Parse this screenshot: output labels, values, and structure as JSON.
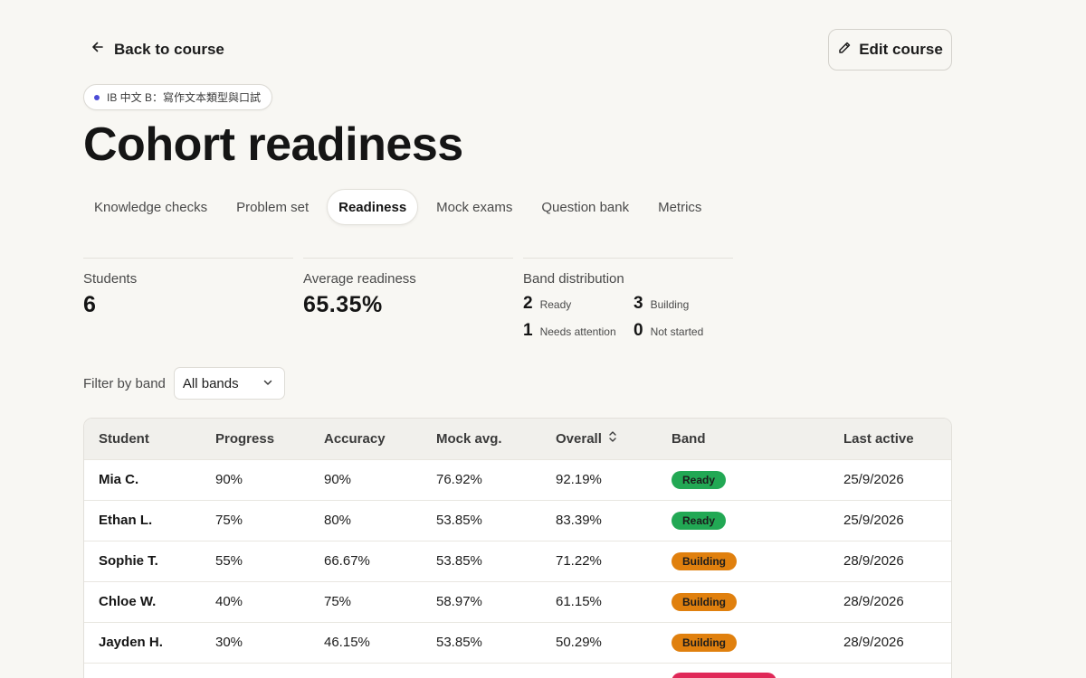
{
  "colors": {
    "ready": "#22a854",
    "building": "#e0800e",
    "needs_attention": "#e02858"
  },
  "nav": {
    "back_label": "Back to course",
    "back_icon": "arrow-left-icon"
  },
  "header": {
    "edit_label": "Edit course",
    "edit_icon": "pencil-icon"
  },
  "course_chip": {
    "label": "IB 中文 B：寫作文本類型與口試"
  },
  "page": {
    "title": "Cohort readiness"
  },
  "tabs": [
    {
      "label": "Knowledge checks",
      "active": false
    },
    {
      "label": "Problem set",
      "active": false
    },
    {
      "label": "Readiness",
      "active": true
    },
    {
      "label": "Mock exams",
      "active": false
    },
    {
      "label": "Question bank",
      "active": false
    },
    {
      "label": "Metrics",
      "active": false
    }
  ],
  "stats": {
    "students": {
      "label": "Students",
      "value": "6"
    },
    "average": {
      "label": "Average readiness",
      "value": "65.35%"
    },
    "bands": {
      "label": "Band distribution",
      "items": [
        {
          "count": "2",
          "name": "Ready"
        },
        {
          "count": "3",
          "name": "Building"
        },
        {
          "count": "1",
          "name": "Needs attention"
        },
        {
          "count": "0",
          "name": "Not started"
        }
      ]
    }
  },
  "filter": {
    "label": "Filter by band",
    "value": "All bands"
  },
  "table": {
    "columns": [
      "Student",
      "Progress",
      "Accuracy",
      "Mock avg.",
      "Overall",
      "Band",
      "Last active"
    ],
    "sort_icon": "sort-updown-icon",
    "rows": [
      {
        "student": "Mia C.",
        "progress": "90%",
        "accuracy": "90%",
        "mock": "76.92%",
        "overall": "92.19%",
        "band": "Ready",
        "band_key": "ready",
        "last": "25/9/2026"
      },
      {
        "student": "Ethan L.",
        "progress": "75%",
        "accuracy": "80%",
        "mock": "53.85%",
        "overall": "83.39%",
        "band": "Ready",
        "band_key": "ready",
        "last": "25/9/2026"
      },
      {
        "student": "Sophie T.",
        "progress": "55%",
        "accuracy": "66.67%",
        "mock": "53.85%",
        "overall": "71.22%",
        "band": "Building",
        "band_key": "building",
        "last": "28/9/2026"
      },
      {
        "student": "Chloe W.",
        "progress": "40%",
        "accuracy": "75%",
        "mock": "58.97%",
        "overall": "61.15%",
        "band": "Building",
        "band_key": "building",
        "last": "28/9/2026"
      },
      {
        "student": "Jayden H.",
        "progress": "30%",
        "accuracy": "46.15%",
        "mock": "53.85%",
        "overall": "50.29%",
        "band": "Building",
        "band_key": "building",
        "last": "28/9/2026"
      },
      {
        "student": "",
        "progress": "",
        "accuracy": "",
        "mock": "",
        "overall": "",
        "band": "",
        "band_key": "needs_attention",
        "last": ""
      }
    ]
  }
}
